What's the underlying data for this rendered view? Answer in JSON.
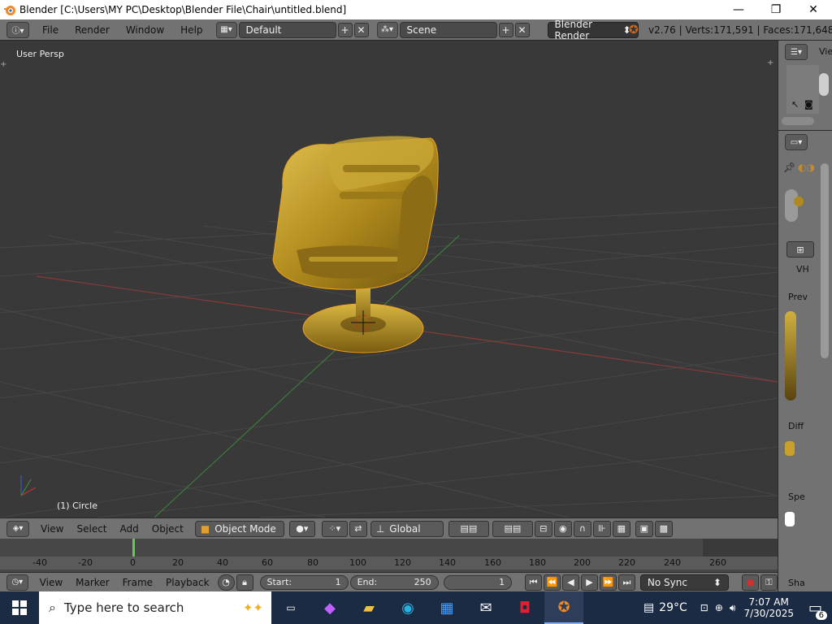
{
  "window": {
    "title": "Blender [C:\\Users\\MY PC\\Desktop\\Blender File\\Chair\\untitled.blend]",
    "minimize": "—",
    "maximize": "❐",
    "close": "✕"
  },
  "info_header": {
    "menus": [
      "File",
      "Render",
      "Window",
      "Help"
    ],
    "screen_layout": "Default",
    "scene": "Scene",
    "render_engine": "Blender Render",
    "stats": "v2.76 | Verts:171,591 | Faces:171,648 | Tris"
  },
  "viewport": {
    "view_label": "User Persp",
    "object_label": "(1) Circle",
    "colors": {
      "chair": "#c8a12a",
      "grid": "#474747",
      "x_axis": "#8a3a3a",
      "y_axis": "#3c7a3c"
    }
  },
  "viewport_header": {
    "menus": [
      "View",
      "Select",
      "Add",
      "Object"
    ],
    "mode": "Object Mode",
    "orientation": "Global"
  },
  "timeline": {
    "ticks": [
      "-40",
      "-20",
      "0",
      "20",
      "40",
      "60",
      "80",
      "100",
      "120",
      "140",
      "160",
      "180",
      "200",
      "220",
      "240",
      "260"
    ],
    "current_frame_marker": "0"
  },
  "timeline_header": {
    "menus": [
      "View",
      "Marker",
      "Frame",
      "Playback"
    ],
    "start_label": "Start:",
    "start_value": "1",
    "end_label": "End:",
    "end_value": "250",
    "current_frame": "1",
    "sync": "No Sync"
  },
  "right_panel": {
    "outliner_header": "Vie",
    "sections": [
      "Prev",
      "Diff",
      "Spe",
      "Sha"
    ],
    "tab_labels": [
      "VH"
    ]
  },
  "taskbar": {
    "search_placeholder": "Type here to search",
    "weather": "29°C",
    "time": "7:07 AM",
    "date": "7/30/2025",
    "notifications": "6"
  }
}
